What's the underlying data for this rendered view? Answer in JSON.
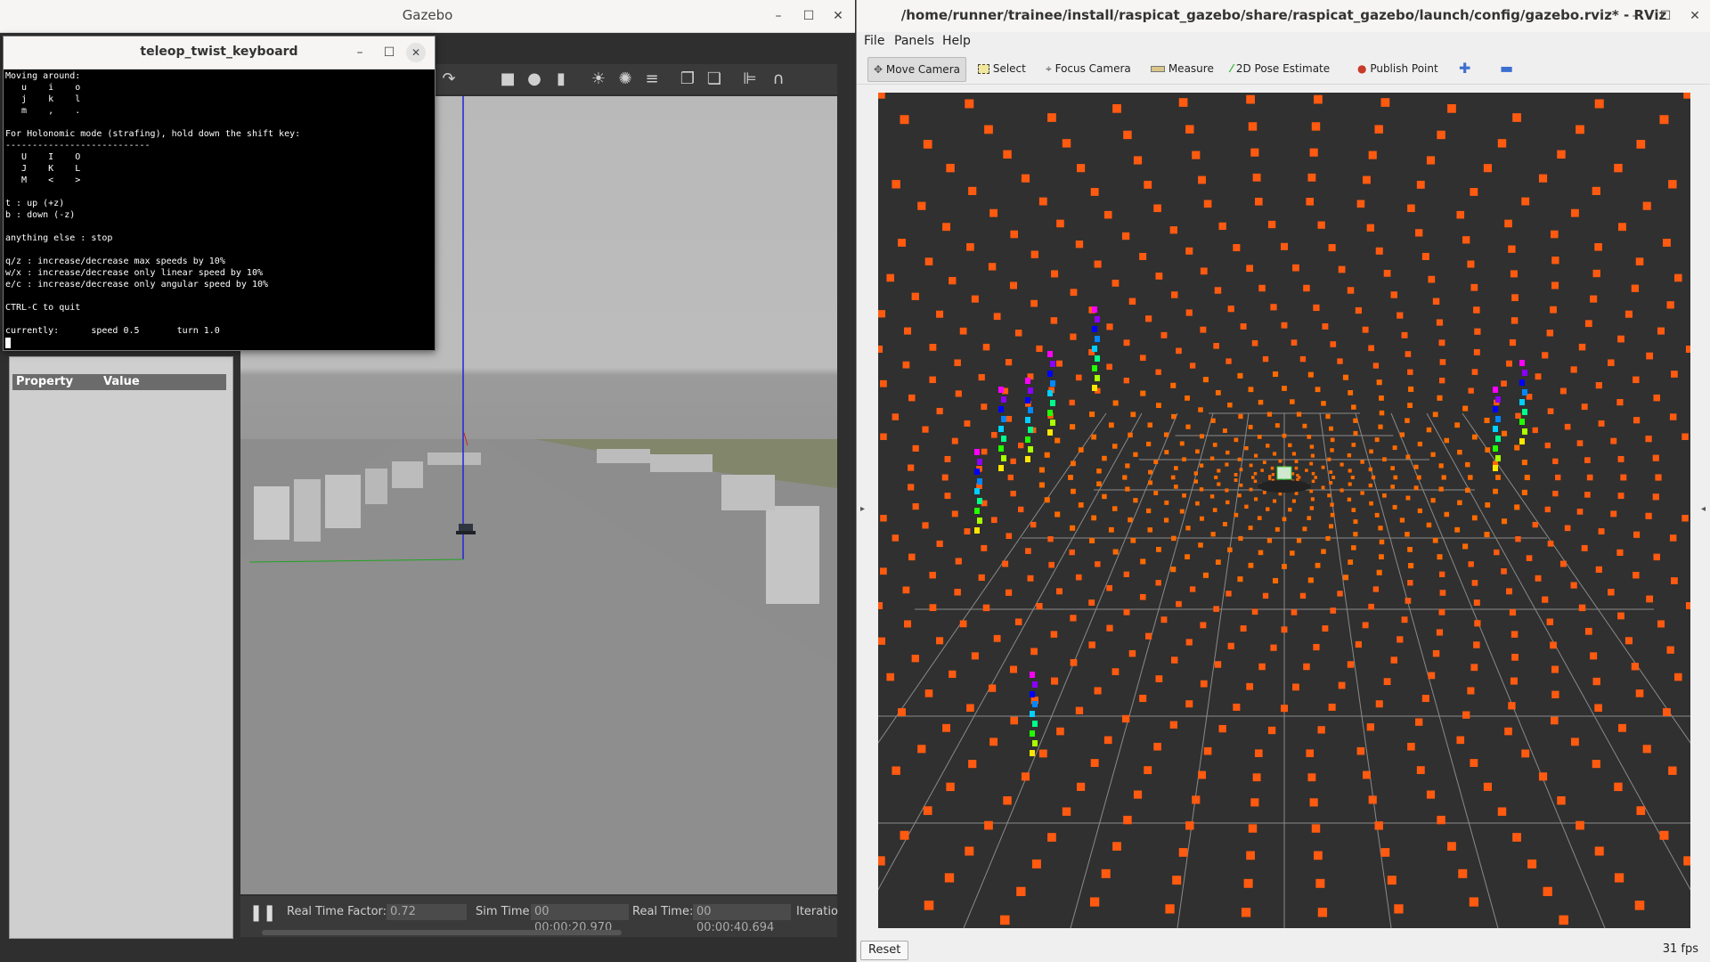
{
  "gazebo": {
    "window_title": "Gazebo",
    "property_header": "Property",
    "value_header": "Value",
    "status": {
      "pause_icon": "pause-icon",
      "real_time_factor_label": "Real Time Factor:",
      "real_time_factor": "0.72",
      "sim_time_label": "Sim Time:",
      "sim_time": "00 00:00:20.970",
      "real_time_label": "Real Time:",
      "real_time": "00 00:00:40.694",
      "iterations_label": "Iteratio"
    }
  },
  "terminal": {
    "title": "teleop_twist_keyboard",
    "lines": [
      "Moving around:",
      "   u    i    o",
      "   j    k    l",
      "   m    ,    .",
      "",
      "For Holonomic mode (strafing), hold down the shift key:",
      "---------------------------",
      "   U    I    O",
      "   J    K    L",
      "   M    <    >",
      "",
      "t : up (+z)",
      "b : down (-z)",
      "",
      "anything else : stop",
      "",
      "q/z : increase/decrease max speeds by 10%",
      "w/x : increase/decrease only linear speed by 10%",
      "e/c : increase/decrease only angular speed by 10%",
      "",
      "CTRL-C to quit",
      "",
      "currently:      speed 0.5       turn 1.0"
    ]
  },
  "rviz": {
    "window_title": "/home/runner/trainee/install/raspicat_gazebo/share/raspicat_gazebo/launch/config/gazebo.rviz* - RViz",
    "menu": [
      "File",
      "Panels",
      "Help"
    ],
    "tools": [
      {
        "label": "Move Camera",
        "icon": "move-camera-icon",
        "active": true
      },
      {
        "label": "Select",
        "icon": "select-icon"
      },
      {
        "label": "Focus Camera",
        "icon": "focus-camera-icon"
      },
      {
        "label": "Measure",
        "icon": "measure-icon"
      },
      {
        "label": "2D Pose Estimate",
        "icon": "pose-estimate-icon"
      },
      {
        "label": "Publish Point",
        "icon": "publish-point-icon"
      }
    ],
    "reset_label": "Reset",
    "fps": "31 fps"
  },
  "window_controls": {
    "minimize": "–",
    "maximize": "☐",
    "close": "✕"
  }
}
